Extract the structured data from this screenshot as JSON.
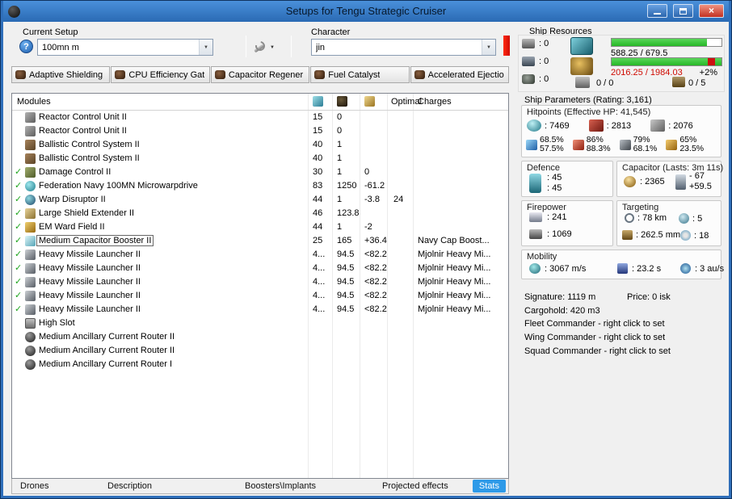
{
  "window": {
    "title": "Setups for Tengu Strategic Cruiser"
  },
  "icons": {
    "help_glyph": "?",
    "dropdown_arrow": "▼",
    "close_glyph": "×",
    "check_glyph": "✓"
  },
  "colors": {
    "alert_red": "#cf0a00",
    "bar_green": "#27b827",
    "over_red": "#cc1111",
    "active_tab_blue": "#2e9ae8",
    "check_green": "#1fa51f"
  },
  "toolbar": {
    "current_setup_label": "Current Setup",
    "current_setup_value": "100mn m",
    "character_label": "Character",
    "character_value": "jin"
  },
  "subsystem_tabs": [
    {
      "label": "Adaptive Shielding"
    },
    {
      "label": "CPU Efficiency Gat"
    },
    {
      "label": "Capacitor Regener"
    },
    {
      "label": "Fuel Catalyst"
    },
    {
      "label": "Accelerated Ejectio"
    }
  ],
  "modules_table": {
    "header_modules": "Modules",
    "header_optimal": "Optimal",
    "header_charges": "Charges",
    "rows": [
      {
        "checked": false,
        "icon": "reactor-control-icon",
        "name": "Reactor Control Unit II",
        "cpu": "15",
        "pg": "0"
      },
      {
        "checked": false,
        "icon": "reactor-control-icon",
        "name": "Reactor Control Unit II",
        "cpu": "15",
        "pg": "0"
      },
      {
        "checked": false,
        "icon": "ballistic-control-icon",
        "name": "Ballistic Control System II",
        "cpu": "40",
        "pg": "1"
      },
      {
        "checked": false,
        "icon": "ballistic-control-icon",
        "name": "Ballistic Control System II",
        "cpu": "40",
        "pg": "1"
      },
      {
        "checked": true,
        "icon": "damage-control-icon",
        "name": "Damage Control II",
        "cpu": "30",
        "pg": "1",
        "cap": "0"
      },
      {
        "checked": true,
        "icon": "microwarpdrive-icon",
        "name": "Federation Navy 100MN Microwarpdrive",
        "cpu": "83",
        "pg": "1250",
        "cap": "-61.2"
      },
      {
        "checked": true,
        "icon": "warp-disruptor-icon",
        "name": "Warp Disruptor II",
        "cpu": "44",
        "pg": "1",
        "cap": "-3.8",
        "optimal": "24"
      },
      {
        "checked": true,
        "icon": "shield-extender-icon",
        "name": "Large Shield Extender II",
        "cpu": "46",
        "pg": "123.8"
      },
      {
        "checked": true,
        "icon": "em-ward-icon",
        "name": "EM Ward Field II",
        "cpu": "44",
        "pg": "1",
        "cap": "-2"
      },
      {
        "checked": true,
        "icon": "cap-booster-icon",
        "name": "Medium Capacitor Booster II",
        "cpu": "25",
        "pg": "165",
        "cap": "+36.4",
        "charges": "Navy Cap Boost...",
        "selected": true
      },
      {
        "checked": true,
        "icon": "missile-launcher-icon",
        "name": "Heavy Missile Launcher II",
        "cpu": "4...",
        "pg": "94.5",
        "cap": "<82.2",
        "charges": "Mjolnir Heavy Mi..."
      },
      {
        "checked": true,
        "icon": "missile-launcher-icon",
        "name": "Heavy Missile Launcher II",
        "cpu": "4...",
        "pg": "94.5",
        "cap": "<82.2",
        "charges": "Mjolnir Heavy Mi..."
      },
      {
        "checked": true,
        "icon": "missile-launcher-icon",
        "name": "Heavy Missile Launcher II",
        "cpu": "4...",
        "pg": "94.5",
        "cap": "<82.2",
        "charges": "Mjolnir Heavy Mi..."
      },
      {
        "checked": true,
        "icon": "missile-launcher-icon",
        "name": "Heavy Missile Launcher II",
        "cpu": "4...",
        "pg": "94.5",
        "cap": "<82.2",
        "charges": "Mjolnir Heavy Mi..."
      },
      {
        "checked": true,
        "icon": "missile-launcher-icon",
        "name": "Heavy Missile Launcher II",
        "cpu": "4...",
        "pg": "94.5",
        "cap": "<82.2",
        "charges": "Mjolnir Heavy Mi..."
      },
      {
        "checked": false,
        "icon": "empty-high-slot-icon",
        "name": "High Slot"
      },
      {
        "checked": false,
        "icon": "rig-icon",
        "name": "Medium Ancillary Current Router II"
      },
      {
        "checked": false,
        "icon": "rig-icon",
        "name": "Medium Ancillary Current Router II"
      },
      {
        "checked": false,
        "icon": "rig-icon",
        "name": "Medium Ancillary Current Router I"
      }
    ]
  },
  "bottom_tabs": [
    {
      "label": "Drones",
      "active": false
    },
    {
      "label": "Description",
      "active": false
    },
    {
      "label": "Boosters\\Implants",
      "active": false
    },
    {
      "label": "Projected effects",
      "active": false
    },
    {
      "label": "Stats",
      "active": true
    }
  ],
  "ship_resources": {
    "title": "Ship Resources",
    "hardpoints": [
      {
        "icon": "turret-hardpoint-icon",
        "value": ": 0"
      },
      {
        "icon": "launcher-hardpoint-icon",
        "value": ": 0"
      },
      {
        "icon": "drone-bay-icon",
        "value": ": 0"
      }
    ],
    "cpu": {
      "text": "588.25 / 679.5",
      "fill_pct": 87
    },
    "powergrid": {
      "text": "2016.25 / 1984.03",
      "over_label": "+2%",
      "fill_pct": 100
    },
    "calibration": "0 / 0",
    "rig_slots": "0 / 5"
  },
  "ship_parameters": {
    "title": "Ship Parameters (Rating: 3,161)",
    "hitpoints": {
      "title": "Hitpoints (Effective HP: 41,545)",
      "pools": [
        {
          "icon": "shield-icon",
          "value": ": 7469"
        },
        {
          "icon": "armor-icon",
          "value": ": 2813"
        },
        {
          "icon": "hull-icon",
          "value": ": 2076"
        }
      ],
      "resists": [
        {
          "icon": "em-resist-icon",
          "shield": "68.5%",
          "armor": "57.5%"
        },
        {
          "icon": "thermal-resist-icon",
          "shield": "86%",
          "armor": "88.3%"
        },
        {
          "icon": "kinetic-resist-icon",
          "shield": "79%",
          "armor": "68.1%"
        },
        {
          "icon": "explosive-resist-icon",
          "shield": "65%",
          "armor": "23.5%"
        }
      ]
    },
    "defence": {
      "title": "Defence",
      "values": [
        ": 45",
        ": 45"
      ]
    },
    "capacitor": {
      "title": "Capacitor (Lasts: 3m 11s)",
      "amount": ": 2365",
      "drain": "- 67",
      "recharge": "+59.5"
    },
    "firepower": {
      "title": "Firepower",
      "dps": ": 241",
      "volley": ": 1069"
    },
    "targeting": {
      "title": "Targeting",
      "range": ": 78 km",
      "max_targets": ": 5",
      "scan_resolution": ": 262.5 mm",
      "sensor_strength": ": 18"
    },
    "mobility": {
      "title": "Mobility",
      "speed": ": 3067 m/s",
      "align_time": ": 23.2 s",
      "warp_speed": ": 3 au/s"
    },
    "signature": "Signature: 1119 m",
    "price": "Price: 0 isk",
    "cargohold": "Cargohold: 420 m3",
    "commanders": [
      "Fleet Commander - right click to set",
      "Wing Commander - right click to set",
      "Squad Commander - right click to set"
    ]
  }
}
